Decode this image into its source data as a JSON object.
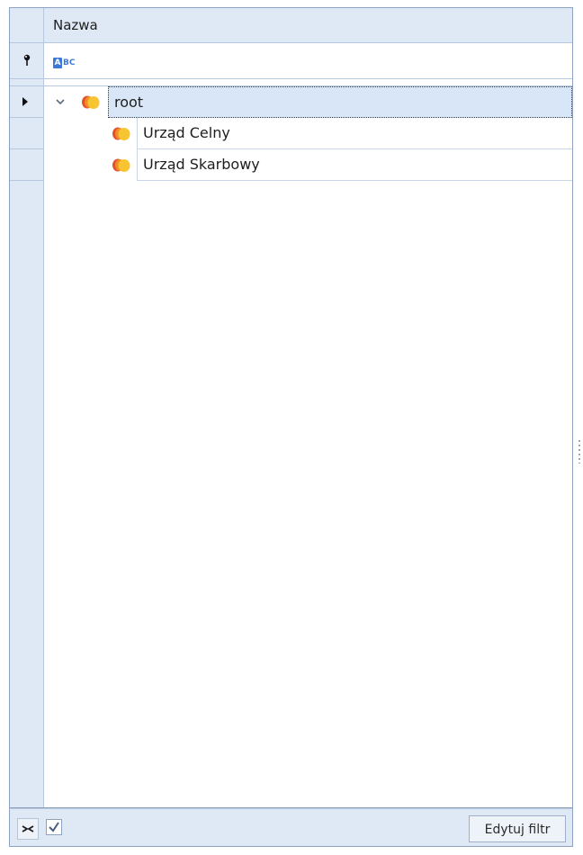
{
  "grid": {
    "column_header": "Nazwa",
    "filter_row": {
      "icon": "abc-filter-icon",
      "pin_icon": "pin-icon",
      "value": ""
    },
    "rows": [
      {
        "label": "root",
        "level": 0,
        "expanded": true,
        "focused": true,
        "icon": "folder-group-icon"
      },
      {
        "label": "Urząd Celny",
        "level": 1,
        "focused": false,
        "icon": "folder-group-icon"
      },
      {
        "label": "Urząd Skarbowy",
        "level": 1,
        "focused": false,
        "icon": "folder-group-icon"
      }
    ]
  },
  "footer": {
    "clear_filter_icon": "clear-filter-icon",
    "filter_enabled": true,
    "edit_filter_label": "Edytuj filtr"
  },
  "colors": {
    "indicator_bg": "#dfe9f5",
    "border": "#8da2c1",
    "focused_row_bg": "#d9e6f7",
    "icon_orange": "#f28c28",
    "icon_yellow": "#f7c531"
  }
}
